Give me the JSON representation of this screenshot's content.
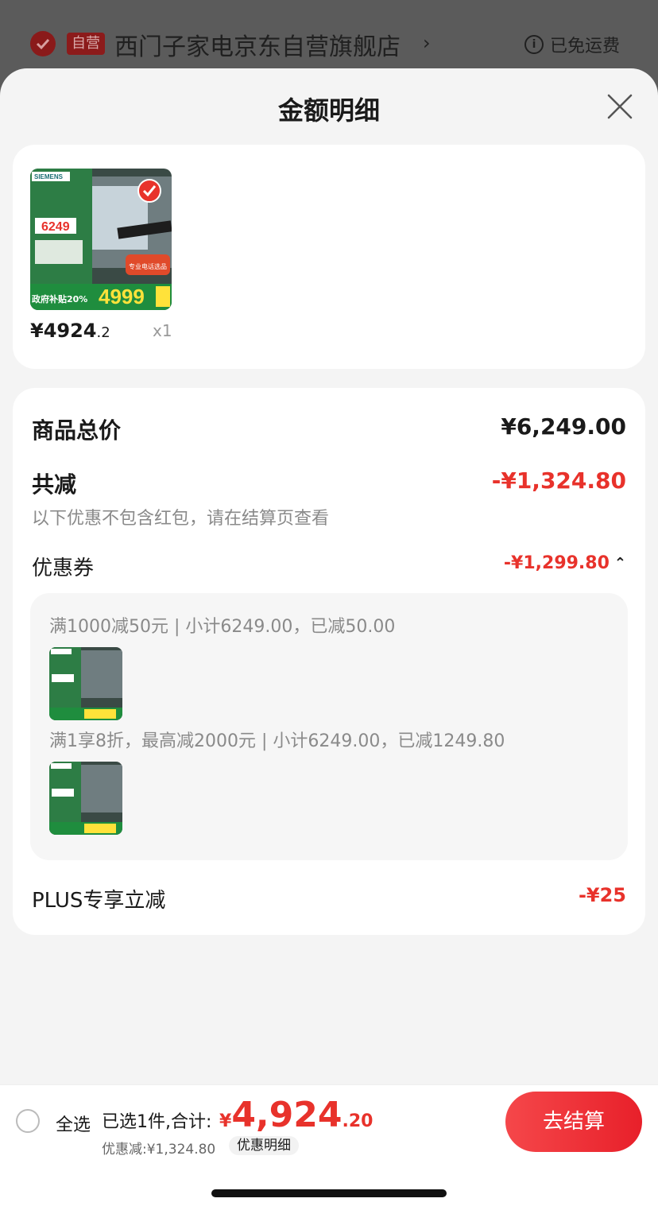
{
  "store": {
    "badge": "自营",
    "name": "西门子家电京东自营旗舰店",
    "chevron": "›",
    "shipping": "已免运费"
  },
  "sheet": {
    "title": "金额明细"
  },
  "product": {
    "image_brand": "SIEMENS",
    "image_promo_price": "4999",
    "image_price_tag": "6249",
    "image_subsidy": "政府补贴20%",
    "image_service": "专业电话选品",
    "price_int": "¥4924",
    "price_dec": ".2",
    "qty": "x1"
  },
  "detail": {
    "total_label": "商品总价",
    "total_value": "¥6,249.00",
    "reduce_label": "共减",
    "reduce_value": "-¥1,324.80",
    "reduce_note": "以下优惠不包含红包，请在结算页查看",
    "coupon_label": "优惠券",
    "coupon_value": "-¥1,299.80",
    "coupon_caret": "⌃",
    "coupons": [
      {
        "text": "满1000减50元 | 小计6249.00，已减50.00"
      },
      {
        "text": "满1享8折，最高减2000元 | 小计6249.00，已减1249.80"
      }
    ],
    "plus_label": "PLUS专享立减",
    "plus_value": "-¥25"
  },
  "bottom": {
    "select_all": "全选",
    "selected": "已选1件,合计:",
    "currency": "¥",
    "total_int": "4,924",
    "total_dec": ".20",
    "discount": "优惠减:¥1,324.80",
    "detail_link": "优惠明细",
    "checkout": "去结算"
  },
  "colors": {
    "accent_red": "#e8322b",
    "sheet_bg": "#f4f4f4"
  }
}
